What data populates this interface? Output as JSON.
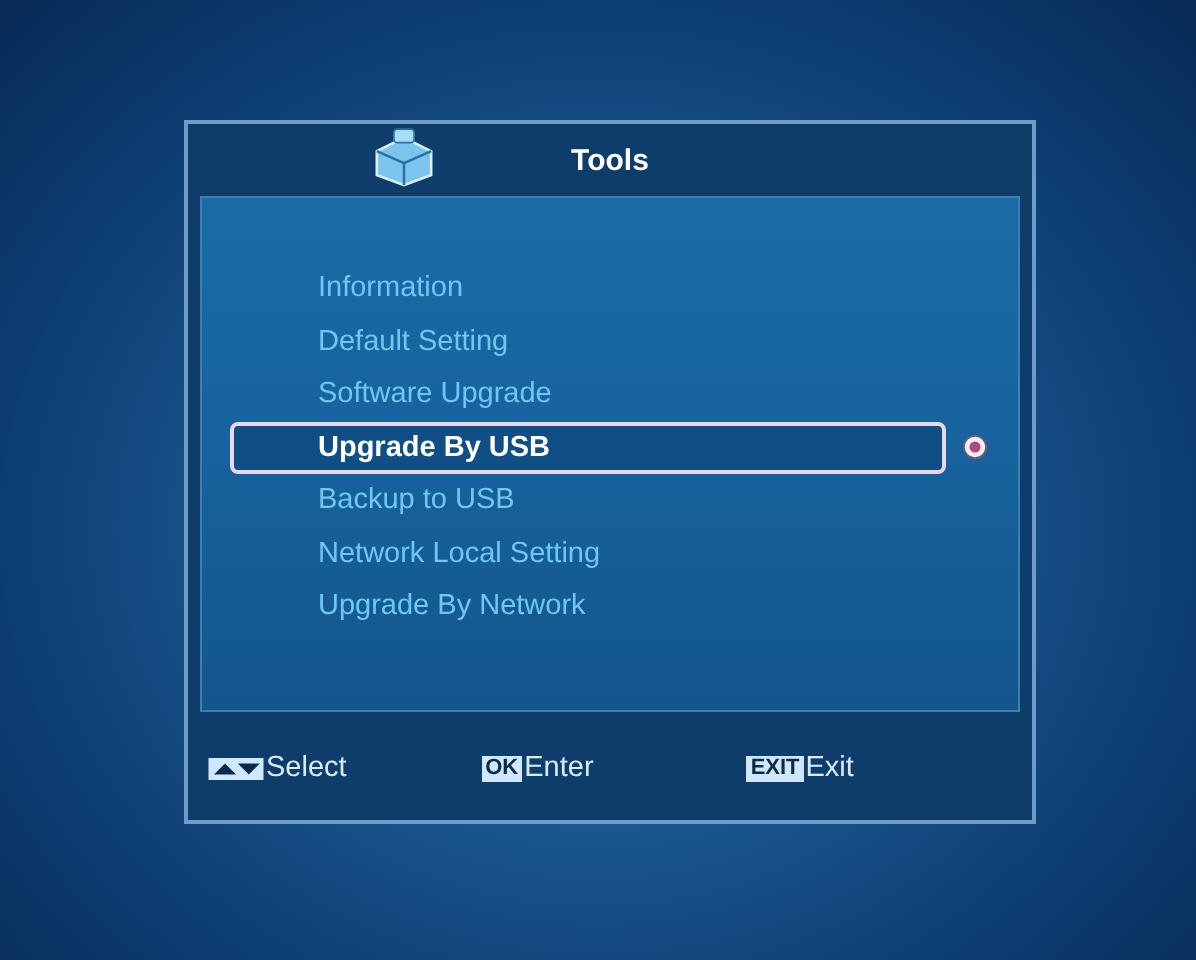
{
  "window": {
    "title": "Tools"
  },
  "menu": [
    {
      "label": "Information",
      "selected": false
    },
    {
      "label": "Default Setting",
      "selected": false
    },
    {
      "label": "Software Upgrade",
      "selected": false
    },
    {
      "label": "Upgrade By USB",
      "selected": true
    },
    {
      "label": "Backup to USB",
      "selected": false
    },
    {
      "label": "Network Local Setting",
      "selected": false
    },
    {
      "label": "Upgrade By Network",
      "selected": false
    }
  ],
  "footer": [
    {
      "kind": "arrows",
      "label": "Select"
    },
    {
      "kind": "key",
      "key": "OK",
      "label": "Enter"
    },
    {
      "kind": "key",
      "key": "EXIT",
      "label": "Exit"
    }
  ]
}
